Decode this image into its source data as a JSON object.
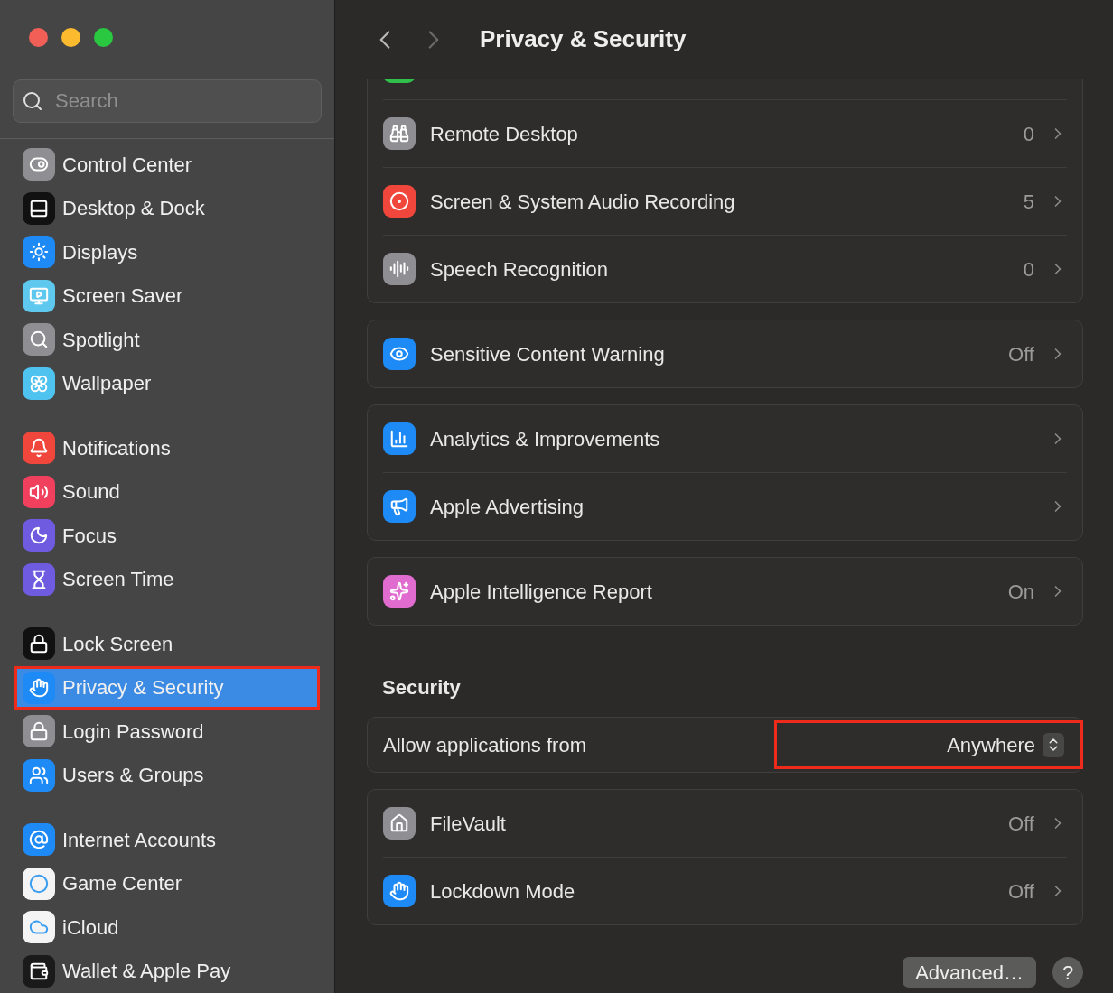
{
  "window": {
    "title": "Privacy & Security"
  },
  "sidebar": {
    "search": {
      "placeholder": "Search"
    },
    "groups": [
      {
        "items": [
          {
            "label": "Control Center",
            "selected": false,
            "outlined": false,
            "color": "#8e8e93"
          },
          {
            "label": "Desktop & Dock",
            "selected": false,
            "outlined": false,
            "color": "#111111"
          },
          {
            "label": "Displays",
            "selected": false,
            "outlined": false,
            "color": "#1d8af5"
          },
          {
            "label": "Screen Saver",
            "selected": false,
            "outlined": false,
            "color": "#5ec8ef"
          },
          {
            "label": "Spotlight",
            "selected": false,
            "outlined": false,
            "color": "#8e8e93"
          },
          {
            "label": "Wallpaper",
            "selected": false,
            "outlined": false,
            "color": "#4fc3ef"
          }
        ]
      },
      {
        "items": [
          {
            "label": "Notifications",
            "selected": false,
            "outlined": false,
            "color": "#f0463c"
          },
          {
            "label": "Sound",
            "selected": false,
            "outlined": false,
            "color": "#f0405d"
          },
          {
            "label": "Focus",
            "selected": false,
            "outlined": false,
            "color": "#6e5be0"
          },
          {
            "label": "Screen Time",
            "selected": false,
            "outlined": false,
            "color": "#6e5be0"
          }
        ]
      },
      {
        "items": [
          {
            "label": "Lock Screen",
            "selected": false,
            "outlined": false,
            "color": "#111111"
          },
          {
            "label": "Privacy & Security",
            "selected": true,
            "outlined": true,
            "color": "#1d8af5"
          },
          {
            "label": "Login Password",
            "selected": false,
            "outlined": false,
            "color": "#8e8e93"
          },
          {
            "label": "Users & Groups",
            "selected": false,
            "outlined": false,
            "color": "#1d8af5"
          }
        ]
      },
      {
        "items": [
          {
            "label": "Internet Accounts",
            "selected": false,
            "outlined": false,
            "color": "#1d8af5"
          },
          {
            "label": "Game Center",
            "selected": false,
            "outlined": false,
            "color": "#f4f4f4"
          },
          {
            "label": "iCloud",
            "selected": false,
            "outlined": false,
            "color": "#f4f4f4"
          },
          {
            "label": "Wallet & Apple Pay",
            "selected": false,
            "outlined": false,
            "color": "#1a1a1a"
          }
        ]
      }
    ]
  },
  "privacy_cards": [
    {
      "rows": [
        {
          "label": "Remote Desktop",
          "value": "0",
          "color": "#8e8e93"
        },
        {
          "label": "Screen & System Audio Recording",
          "value": "5",
          "color": "#f0463c"
        },
        {
          "label": "Speech Recognition",
          "value": "0",
          "color": "#8e8e93"
        }
      ]
    },
    {
      "rows": [
        {
          "label": "Sensitive Content Warning",
          "value": "Off",
          "color": "#1d8af5"
        }
      ]
    },
    {
      "rows": [
        {
          "label": "Analytics & Improvements",
          "color": "#1d8af5"
        },
        {
          "label": "Apple Advertising",
          "color": "#1d8af5"
        }
      ]
    },
    {
      "rows": [
        {
          "label": "Apple Intelligence Report",
          "value": "On",
          "color": "#e06cd0"
        }
      ]
    }
  ],
  "security": {
    "title": "Security",
    "allow_applications": {
      "label": "Allow applications from",
      "value": "Anywhere",
      "outlined": true
    },
    "rows": [
      {
        "label": "FileVault",
        "value": "Off",
        "color": "#8e8e93"
      },
      {
        "label": "Lockdown Mode",
        "value": "Off",
        "color": "#1d8af5"
      }
    ]
  },
  "footer": {
    "advanced_button": "Advanced…",
    "help_button": "?"
  }
}
